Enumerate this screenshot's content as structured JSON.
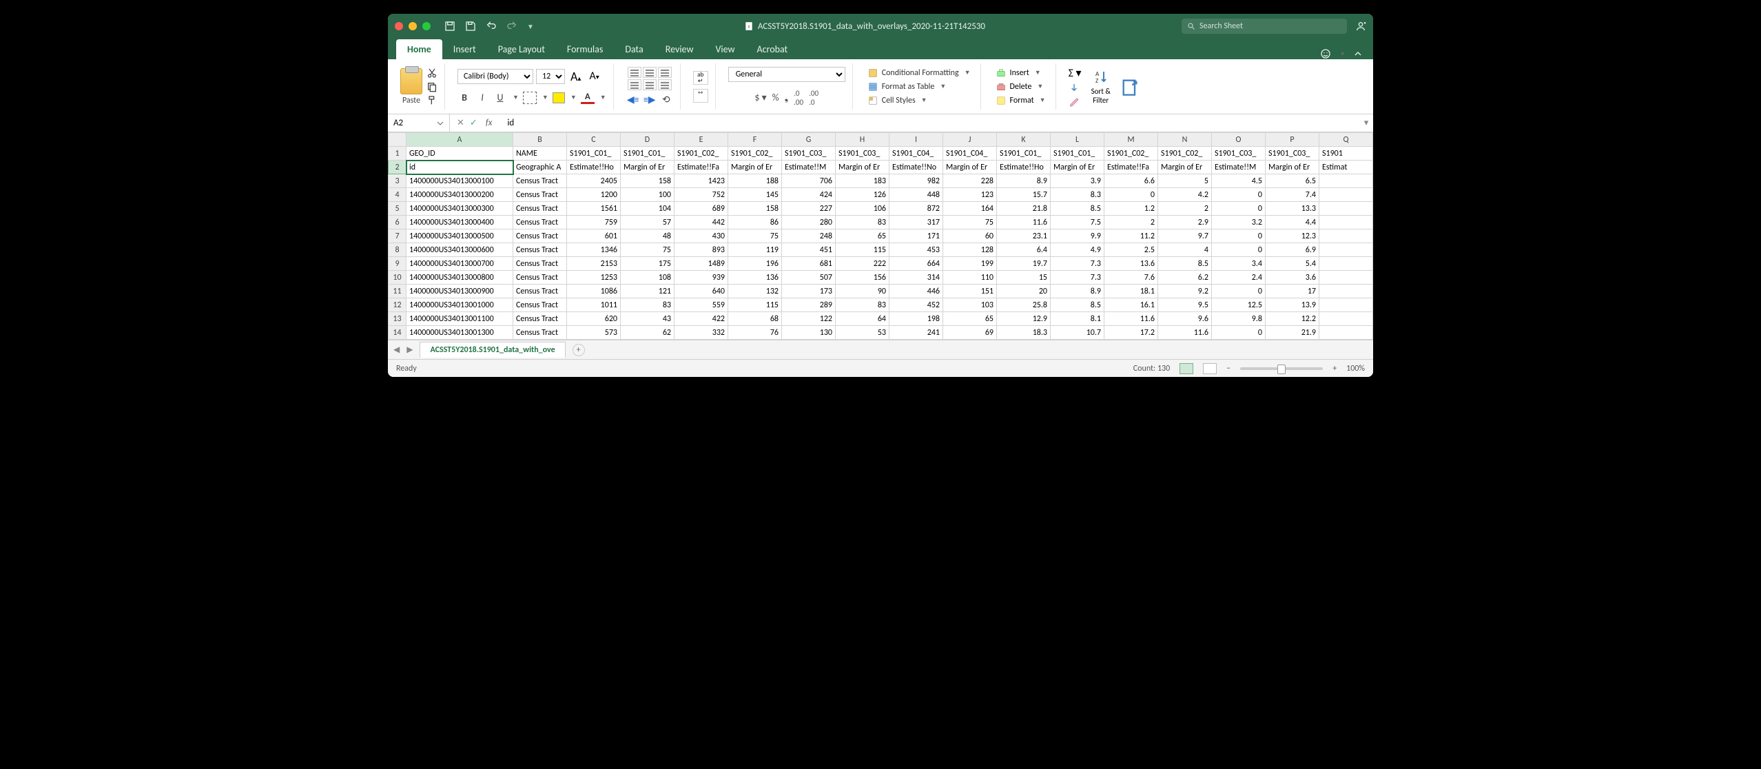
{
  "title": "ACSST5Y2018.S1901_data_with_overlays_2020-11-21T142530",
  "search_placeholder": "Search Sheet",
  "tabs": [
    "Home",
    "Insert",
    "Page Layout",
    "Formulas",
    "Data",
    "Review",
    "View",
    "Acrobat"
  ],
  "active_tab": "Home",
  "paste_label": "Paste",
  "font_name": "Calibri (Body)",
  "font_size": "12",
  "number_format": "General",
  "styles": {
    "cond": "Conditional Formatting",
    "table": "Format as Table",
    "cell": "Cell Styles"
  },
  "cells": {
    "insert": "Insert",
    "delete": "Delete",
    "format": "Format"
  },
  "sort_label": "Sort &\nFilter",
  "namebox": "A2",
  "formula": "id",
  "sheet_tab": "ACSST5Y2018.S1901_data_with_ove",
  "status_ready": "Ready",
  "status_count": "Count: 130",
  "zoom": "100%",
  "columns": [
    "A",
    "B",
    "C",
    "D",
    "E",
    "F",
    "G",
    "H",
    "I",
    "J",
    "K",
    "L",
    "M",
    "N",
    "O",
    "P",
    "Q"
  ],
  "row1": [
    "GEO_ID",
    "NAME",
    "S1901_C01_",
    "S1901_C01_",
    "S1901_C02_",
    "S1901_C02_",
    "S1901_C03_",
    "S1901_C03_",
    "S1901_C04_",
    "S1901_C04_",
    "S1901_C01_",
    "S1901_C01_",
    "S1901_C02_",
    "S1901_C02_",
    "S1901_C03_",
    "S1901_C03_",
    "S1901"
  ],
  "row2": [
    "id",
    "Geographic A",
    "Estimate!!Ho",
    "Margin of Er",
    "Estimate!!Fa",
    "Margin of Er",
    "Estimate!!M",
    "Margin of Er",
    "Estimate!!No",
    "Margin of Er",
    "Estimate!!Ho",
    "Margin of Er",
    "Estimate!!Fa",
    "Margin of Er",
    "Estimate!!M",
    "Margin of Er",
    "Estimat"
  ],
  "data_rows": [
    {
      "n": 3,
      "c": [
        "1400000US34013000100",
        "Census Tract",
        "2405",
        "158",
        "1423",
        "188",
        "706",
        "183",
        "982",
        "228",
        "8.9",
        "3.9",
        "6.6",
        "5",
        "4.5",
        "6.5",
        ""
      ]
    },
    {
      "n": 4,
      "c": [
        "1400000US34013000200",
        "Census Tract",
        "1200",
        "100",
        "752",
        "145",
        "424",
        "126",
        "448",
        "123",
        "15.7",
        "8.3",
        "0",
        "4.2",
        "0",
        "7.4",
        ""
      ]
    },
    {
      "n": 5,
      "c": [
        "1400000US34013000300",
        "Census Tract",
        "1561",
        "104",
        "689",
        "158",
        "227",
        "106",
        "872",
        "164",
        "21.8",
        "8.5",
        "1.2",
        "2",
        "0",
        "13.3",
        ""
      ]
    },
    {
      "n": 6,
      "c": [
        "1400000US34013000400",
        "Census Tract",
        "759",
        "57",
        "442",
        "86",
        "280",
        "83",
        "317",
        "75",
        "11.6",
        "7.5",
        "2",
        "2.9",
        "3.2",
        "4.4",
        ""
      ]
    },
    {
      "n": 7,
      "c": [
        "1400000US34013000500",
        "Census Tract",
        "601",
        "48",
        "430",
        "75",
        "248",
        "65",
        "171",
        "60",
        "23.1",
        "9.9",
        "11.2",
        "9.7",
        "0",
        "12.3",
        ""
      ]
    },
    {
      "n": 8,
      "c": [
        "1400000US34013000600",
        "Census Tract",
        "1346",
        "75",
        "893",
        "119",
        "451",
        "115",
        "453",
        "128",
        "6.4",
        "4.9",
        "2.5",
        "4",
        "0",
        "6.9",
        ""
      ]
    },
    {
      "n": 9,
      "c": [
        "1400000US34013000700",
        "Census Tract",
        "2153",
        "175",
        "1489",
        "196",
        "681",
        "222",
        "664",
        "199",
        "19.7",
        "7.3",
        "13.6",
        "8.5",
        "3.4",
        "5.4",
        ""
      ]
    },
    {
      "n": 10,
      "c": [
        "1400000US34013000800",
        "Census Tract",
        "1253",
        "108",
        "939",
        "136",
        "507",
        "156",
        "314",
        "110",
        "15",
        "7.3",
        "7.6",
        "6.2",
        "2.4",
        "3.6",
        ""
      ]
    },
    {
      "n": 11,
      "c": [
        "1400000US34013000900",
        "Census Tract",
        "1086",
        "121",
        "640",
        "132",
        "173",
        "90",
        "446",
        "151",
        "20",
        "8.9",
        "18.1",
        "9.2",
        "0",
        "17",
        ""
      ]
    },
    {
      "n": 12,
      "c": [
        "1400000US34013001000",
        "Census Tract",
        "1011",
        "83",
        "559",
        "115",
        "289",
        "83",
        "452",
        "103",
        "25.8",
        "8.5",
        "16.1",
        "9.5",
        "12.5",
        "13.9",
        ""
      ]
    },
    {
      "n": 13,
      "c": [
        "1400000US34013001100",
        "Census Tract",
        "620",
        "43",
        "422",
        "68",
        "122",
        "64",
        "198",
        "65",
        "12.9",
        "8.1",
        "11.6",
        "9.6",
        "9.8",
        "12.2",
        ""
      ]
    },
    {
      "n": 14,
      "c": [
        "1400000US34013001300",
        "Census Tract",
        "573",
        "62",
        "332",
        "76",
        "130",
        "53",
        "241",
        "69",
        "18.3",
        "10.7",
        "17.2",
        "11.6",
        "0",
        "21.9",
        ""
      ]
    }
  ]
}
